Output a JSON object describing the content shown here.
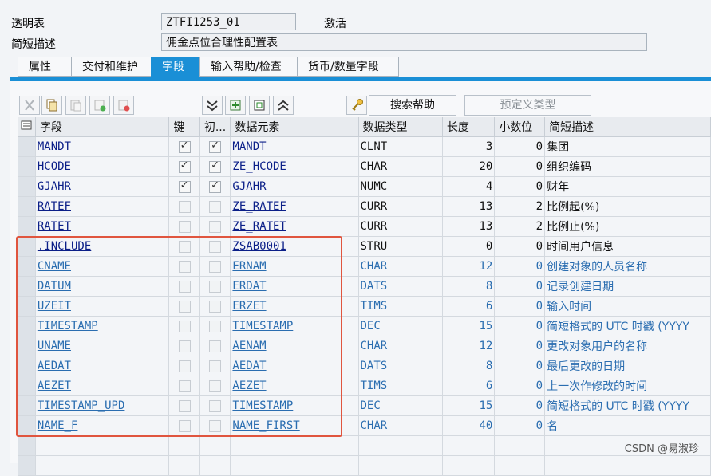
{
  "header": {
    "table_label": "透明表",
    "table_name": "ZTFI1253_01",
    "status": "激活",
    "desc_label": "简短描述",
    "desc_value": "佣金点位合理性配置表"
  },
  "tabs": [
    "属性",
    "交付和维护",
    "字段",
    "输入帮助/检查",
    "货币/数量字段"
  ],
  "active_tab": "字段",
  "toolbar": {
    "search_help": "搜索帮助",
    "predefined_type": "预定义类型"
  },
  "columns": [
    "字段",
    "键",
    "初...",
    "数据元素",
    "数据类型",
    "长度",
    "小数位",
    "简短描述"
  ],
  "rows": [
    {
      "field": "MANDT",
      "key": true,
      "init": true,
      "element": "MANDT",
      "type": "CLNT",
      "length": "3",
      "dec": "0",
      "desc": "集团"
    },
    {
      "field": "HCODE",
      "key": true,
      "init": true,
      "element": "ZE_HCODE",
      "type": "CHAR",
      "length": "20",
      "dec": "0",
      "desc": "组织编码"
    },
    {
      "field": "GJAHR",
      "key": true,
      "init": true,
      "element": "GJAHR",
      "type": "NUMC",
      "length": "4",
      "dec": "0",
      "desc": "财年"
    },
    {
      "field": "RATEF",
      "key": false,
      "init": false,
      "element": "ZE_RATEF",
      "type": "CURR",
      "length": "13",
      "dec": "2",
      "desc": "比例起(%)"
    },
    {
      "field": "RATET",
      "key": false,
      "init": false,
      "element": "ZE_RATET",
      "type": "CURR",
      "length": "13",
      "dec": "2",
      "desc": "比例止(%)"
    },
    {
      "field": ".INCLUDE",
      "key": false,
      "init": false,
      "element": "ZSAB0001",
      "type": "STRU",
      "length": "0",
      "dec": "0",
      "desc": "时间用户信息"
    },
    {
      "field": "CNAME",
      "key": false,
      "init": false,
      "element": "ERNAM",
      "type": "CHAR",
      "length": "12",
      "dec": "0",
      "desc": "创建对象的人员名称",
      "inc": true
    },
    {
      "field": "DATUM",
      "key": false,
      "init": false,
      "element": "ERDAT",
      "type": "DATS",
      "length": "8",
      "dec": "0",
      "desc": "记录创建日期",
      "inc": true
    },
    {
      "field": "UZEIT",
      "key": false,
      "init": false,
      "element": "ERZET",
      "type": "TIMS",
      "length": "6",
      "dec": "0",
      "desc": "输入时间",
      "inc": true
    },
    {
      "field": "TIMESTAMP",
      "key": false,
      "init": false,
      "element": "TIMESTAMP",
      "type": "DEC",
      "length": "15",
      "dec": "0",
      "desc": "简短格式的 UTC 时戳 (YYYY",
      "inc": true
    },
    {
      "field": "UNAME",
      "key": false,
      "init": false,
      "element": "AENAM",
      "type": "CHAR",
      "length": "12",
      "dec": "0",
      "desc": "更改对象用户的名称",
      "inc": true
    },
    {
      "field": "AEDAT",
      "key": false,
      "init": false,
      "element": "AEDAT",
      "type": "DATS",
      "length": "8",
      "dec": "0",
      "desc": "最后更改的日期",
      "inc": true
    },
    {
      "field": "AEZET",
      "key": false,
      "init": false,
      "element": "AEZET",
      "type": "TIMS",
      "length": "6",
      "dec": "0",
      "desc": "上一次作修改的时间",
      "inc": true
    },
    {
      "field": "TIMESTAMP_UPD",
      "key": false,
      "init": false,
      "element": "TIMESTAMP",
      "type": "DEC",
      "length": "15",
      "dec": "0",
      "desc": "简短格式的 UTC 时戳 (YYYY",
      "inc": true
    },
    {
      "field": "NAME_F",
      "key": false,
      "init": false,
      "element": "NAME_FIRST",
      "type": "CHAR",
      "length": "40",
      "dec": "0",
      "desc": "名",
      "inc": true
    }
  ],
  "watermark": "CSDN @易淑珍",
  "colors": {
    "active_tab": "#1a8fd6",
    "highlight_box": "#e0553f",
    "include_text": "#2a6db0"
  }
}
